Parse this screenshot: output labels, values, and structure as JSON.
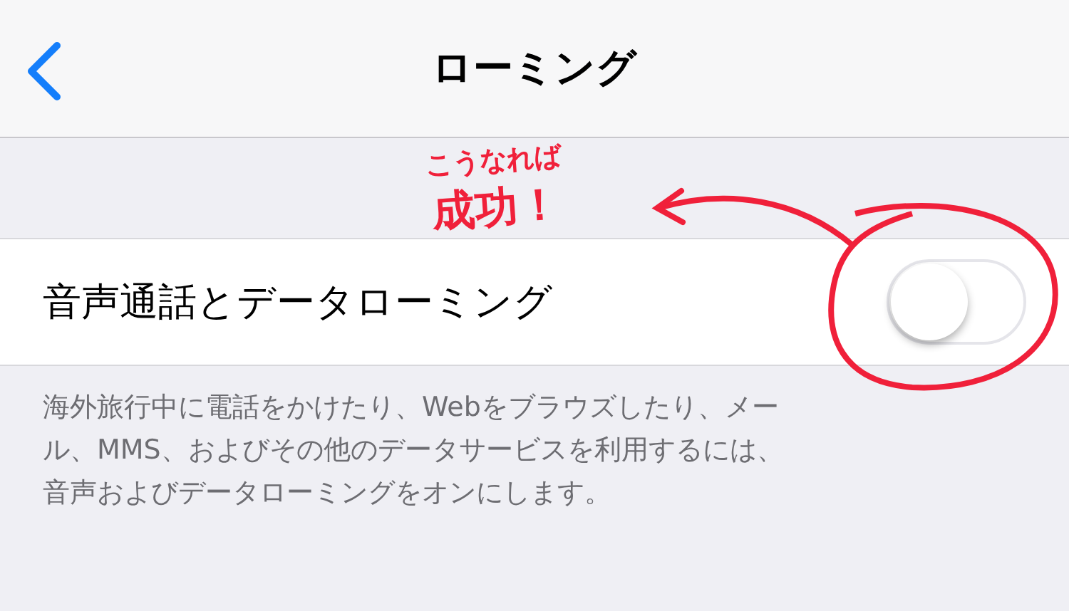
{
  "nav": {
    "title": "ローミング"
  },
  "row": {
    "label": "音声通話とデータローミング",
    "on": false
  },
  "footer_lines": [
    "海外旅行中に電話をかけたり、Webをブラウズしたり、メー",
    "ル、MMS、およびその他のデータサービスを利用するには、",
    "音声およびデータローミングをオンにします。"
  ],
  "annotation": {
    "lines": [
      "こうなれば",
      "成功！"
    ]
  }
}
